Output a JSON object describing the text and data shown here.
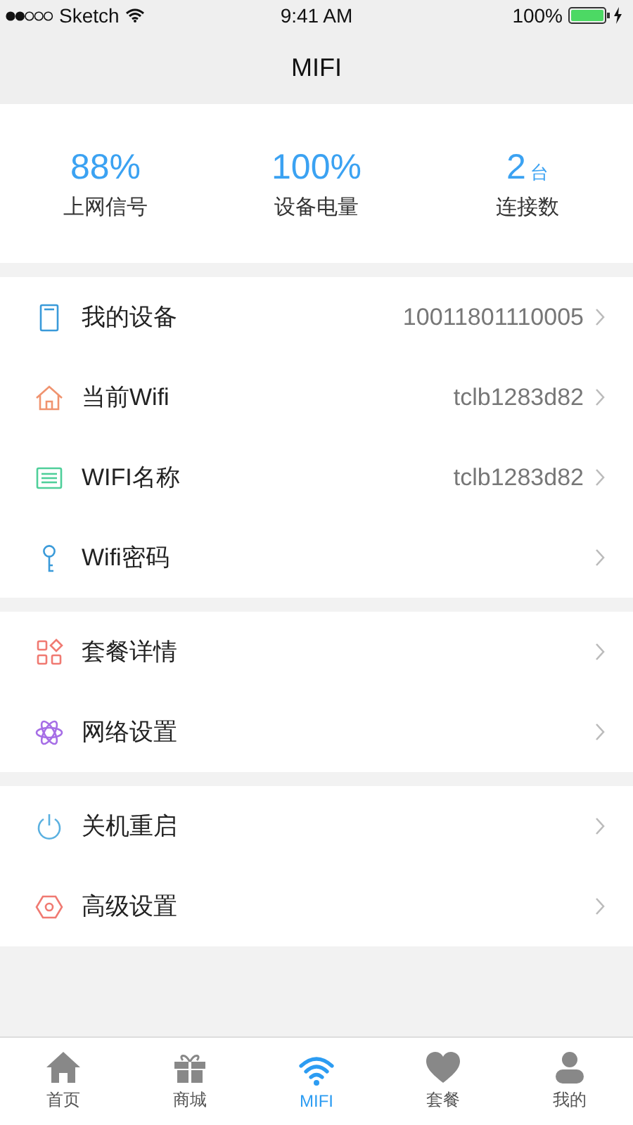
{
  "status_bar": {
    "carrier": "Sketch",
    "time": "9:41 AM",
    "battery": "100%"
  },
  "nav_bar": {
    "title": "MIFI"
  },
  "stats": [
    {
      "value": "88%",
      "label": "上网信号"
    },
    {
      "value": "100%",
      "label": "设备电量"
    },
    {
      "value": "2",
      "unit": "台",
      "label": "连接数"
    }
  ],
  "groups": [
    [
      {
        "kind": "device",
        "color": "#3a9ad9",
        "label": "我的设备",
        "value": "10011801110005"
      },
      {
        "kind": "home",
        "color": "#f0936f",
        "label": "当前Wifi",
        "value": "tclb1283d82"
      },
      {
        "kind": "list",
        "color": "#4fcf9a",
        "label": "WIFI名称",
        "value": "tclb1283d82"
      },
      {
        "kind": "key",
        "color": "#3a9ad9",
        "label": "Wifi密码"
      }
    ],
    [
      {
        "kind": "grid",
        "color": "#f07a72",
        "label": "套餐详情"
      },
      {
        "kind": "atom",
        "color": "#a66ee6",
        "label": "网络设置"
      }
    ],
    [
      {
        "kind": "power",
        "color": "#5ab0e0",
        "label": "关机重启"
      },
      {
        "kind": "hexagon",
        "color": "#f07a72",
        "label": "高级设置"
      }
    ]
  ],
  "tab_bar": [
    {
      "kind": "home",
      "label": "首页",
      "selected": false
    },
    {
      "kind": "gift",
      "label": "商城",
      "selected": false
    },
    {
      "kind": "wifi",
      "label": "MIFI",
      "selected": true
    },
    {
      "kind": "heart",
      "label": "套餐",
      "selected": false
    },
    {
      "kind": "person",
      "label": "我的",
      "selected": false
    }
  ]
}
